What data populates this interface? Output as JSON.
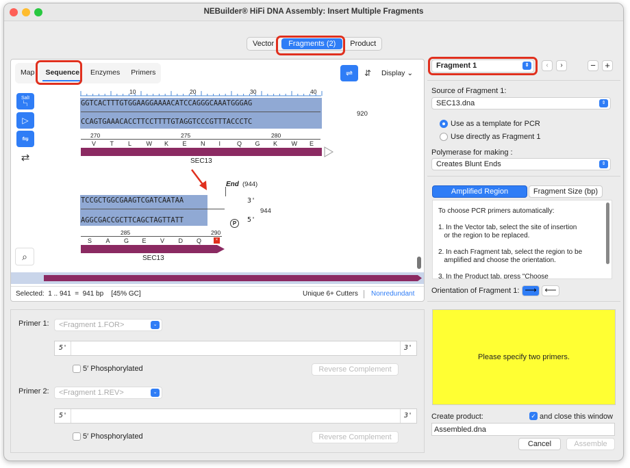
{
  "window": {
    "title": "NEBuilder® HiFi DNA Assembly: Insert Multiple Fragments"
  },
  "main_tabs": [
    {
      "label": "Vector"
    },
    {
      "label": "Fragments (2)"
    },
    {
      "label": "Product"
    }
  ],
  "view_tabs": [
    {
      "label": "Map"
    },
    {
      "label": "Sequence"
    },
    {
      "label": "Enzymes"
    },
    {
      "label": "Primers"
    }
  ],
  "toolbar": {
    "display_label": "Display",
    "salI_label": "SalI"
  },
  "sequence": {
    "ruler": [
      "10",
      "20",
      "30",
      "40"
    ],
    "top1_strand": "GGTCACTTTGTGGAAGGAAAACATCCAGGGCAAATGGGAG",
    "top1_comp": "CCAGTGAAACACCTTCCTTTTGTAGGTCCCGTTTACCCTC",
    "top1_pos": "920",
    "aa_nums1": [
      "270",
      "275",
      "280"
    ],
    "aa1": [
      "V",
      "T",
      "L",
      "W",
      "K",
      "E",
      "N",
      "I",
      "Q",
      "G",
      "K",
      "W",
      "E"
    ],
    "feature1": "SEC13",
    "end_label": "End",
    "end_pos": "(944)",
    "top2_strand": "TCCGCTGGCGAAGTCGATCAATAA",
    "top2_3prime": "3'",
    "top2_comp": "AGGCGACCGCTTCAGCTAGTTATT",
    "top2_5prime": "5'",
    "top2_pos": "944",
    "phos_symbol": "P",
    "aa_nums2": [
      "285",
      "290"
    ],
    "aa2": [
      "S",
      "A",
      "G",
      "E",
      "V",
      "D",
      "Q"
    ],
    "feature2": "SEC13"
  },
  "status": {
    "selected_label": "Selected:",
    "range": "1 .. 941",
    "eq": "=",
    "bp": "941 bp",
    "gc": "[45% GC]",
    "cutters": "Unique 6+ Cutters",
    "nonredundant": "Nonredundant"
  },
  "primers": {
    "p1_label": "Primer 1:",
    "p1_placeholder": "<Fragment 1.FOR>",
    "p2_label": "Primer 2:",
    "p2_placeholder": "<Fragment 1.REV>",
    "five": "5'",
    "three": "3'",
    "phos_label": "5′ Phosphorylated",
    "revcomp": "Reverse Complement"
  },
  "right": {
    "fragment_select": "Fragment 1",
    "source_label": "Source of Fragment 1:",
    "source_value": "SEC13.dna",
    "opt1": "Use as a template for PCR",
    "opt2": "Use directly as Fragment 1",
    "polymerase_label": "Polymerase for making :",
    "polymerase_value": "Creates Blunt Ends",
    "tab_amplified": "Amplified Region",
    "tab_size": "Fragment Size (bp)",
    "help_lines": [
      "To choose PCR primers automatically:",
      "1. In the Vector tab, select the site of insertion",
      "   or the region to be replaced.",
      "2. In each Fragment tab, select the region to be",
      "   amplified and choose the orientation.",
      "3. In the Product tab, press \"Choose"
    ],
    "orientation_label": "Orientation of Fragment 1:",
    "message": "Please specify two primers.",
    "create_label": "Create product:",
    "close_label": "and close this window",
    "product_name": "Assembled.dna",
    "cancel": "Cancel",
    "assemble": "Assemble"
  },
  "colors": {
    "accent": "#2f7df6",
    "feature": "#8b2a62",
    "highlight": "#90a9d4",
    "message_bg": "#ffff33",
    "annotation": "#e0301e"
  }
}
